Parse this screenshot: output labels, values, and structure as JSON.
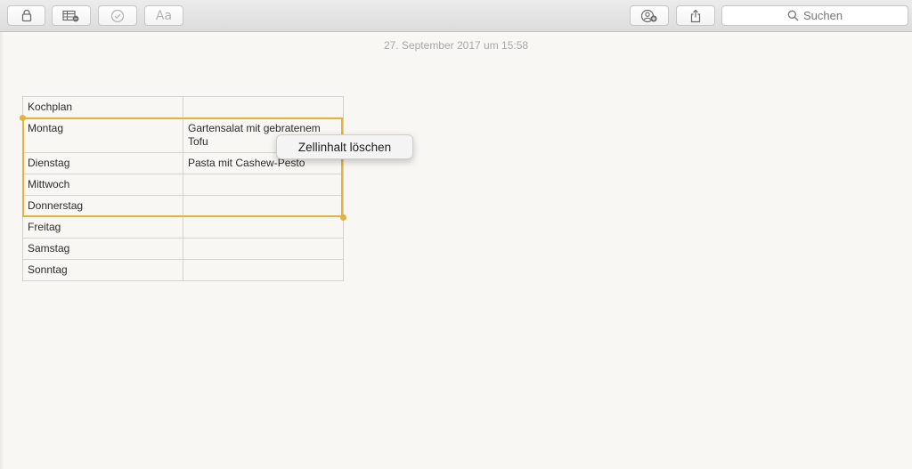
{
  "toolbar": {
    "buttons": [
      {
        "icon": "lock-icon"
      },
      {
        "icon": "table-icon"
      },
      {
        "icon": "checklist-icon"
      },
      {
        "icon": "format-icon",
        "label": "Aa"
      },
      {
        "icon": "add-people-icon"
      },
      {
        "icon": "share-icon"
      }
    ],
    "search": {
      "icon": "search-icon",
      "placeholder": "Suchen"
    }
  },
  "note": {
    "date": "27. September 2017 um 15:58",
    "table": {
      "rows": [
        [
          "Kochplan",
          ""
        ],
        [
          "Montag",
          "Gartensalat mit gebratenem Tofu"
        ],
        [
          "Dienstag",
          "Pasta mit Cashew-Pesto"
        ],
        [
          "Mittwoch",
          ""
        ],
        [
          "Donnerstag",
          ""
        ],
        [
          "Freitag",
          ""
        ],
        [
          "Samstag",
          ""
        ],
        [
          "Sonntag",
          ""
        ]
      ],
      "selected_rows": [
        1,
        4
      ]
    }
  },
  "context_menu": {
    "items": [
      {
        "label": "Zellinhalt löschen"
      }
    ]
  },
  "colors": {
    "selection": "#e2b23a",
    "paper": "#f8f7f4",
    "toolbar": "#e4e4e4"
  }
}
